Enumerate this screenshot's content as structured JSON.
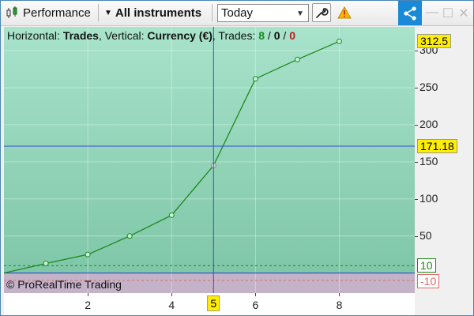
{
  "toolbar": {
    "title": "Performance",
    "instrument_selector": "All instruments",
    "period": "Today",
    "icons": [
      "candlestick-chart-icon",
      "dropdown-arrow-icon",
      "wrench-icon",
      "warning-icon",
      "share-icon",
      "minimize-icon",
      "maximize-icon",
      "close-icon"
    ],
    "window_buttons": [
      "—",
      "☐",
      "✕"
    ]
  },
  "legend": {
    "horizontal_prefix": "Horizontal: ",
    "horizontal_value": "Trades",
    "vertical_prefix": ", Vertical: ",
    "vertical_value": "Currency (€)",
    "trades_prefix": ", Trades: ",
    "trades_total": "8",
    "slash1": " / ",
    "trades_mid": "0",
    "slash2": " / ",
    "trades_losing": "0"
  },
  "copyright": "© ProRealTime Trading",
  "colors": {
    "line": "#1a8a1a",
    "crosshair": "#3a48e0",
    "plot_top": "#a8e3cb",
    "plot_bottom": "#7cc4a5",
    "negative_band": "#c4b2c8",
    "threshold_positive": "#1a8a1a",
    "threshold_negative": "#e06a6a",
    "badge": "#ffee00"
  },
  "chart_data": {
    "type": "line",
    "x": [
      0,
      1,
      2,
      3,
      4,
      5,
      6,
      7,
      8
    ],
    "values": [
      0,
      13,
      25,
      50,
      78,
      145,
      262,
      288,
      312.5
    ],
    "xlim": [
      0,
      9.8
    ],
    "ylim": [
      -27,
      332
    ],
    "x_ticks": [
      2,
      4,
      6,
      8
    ],
    "y_ticks": [
      50,
      100,
      150,
      200,
      250,
      300
    ],
    "thresholds": [
      10,
      -10
    ],
    "threshold_labels": [
      "10",
      "-10"
    ],
    "last_value_label": "312.5",
    "crosshair": {
      "x": 5,
      "y": 171.18,
      "x_label": "5",
      "y_label": "171.18"
    },
    "grid": true
  }
}
